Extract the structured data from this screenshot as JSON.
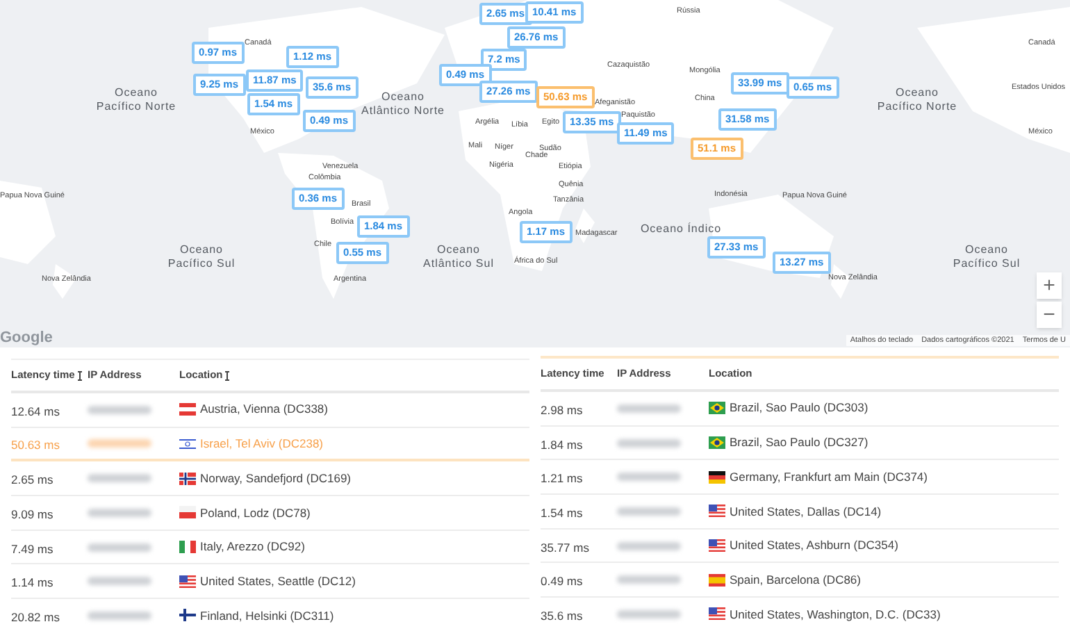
{
  "map": {
    "labels": [
      {
        "kind": "ocean",
        "text": "Oceano Pacífico Norte"
      },
      {
        "kind": "ocean",
        "text": "Oceano Atlântico Norte"
      },
      {
        "kind": "ocean",
        "text": "Oceano Pacífico Sul"
      },
      {
        "kind": "ocean",
        "text": "Oceano Atlântico Sul"
      },
      {
        "kind": "ocean",
        "text": "Oceano Índico"
      },
      {
        "kind": "ocean",
        "text": "Oceano Pacífico Norte"
      },
      {
        "kind": "ocean",
        "text": "Oceano Pacífico Sul"
      },
      {
        "kind": "country",
        "text": "Canadá"
      },
      {
        "kind": "country",
        "text": "México"
      },
      {
        "kind": "country",
        "text": "Venezuela"
      },
      {
        "kind": "country",
        "text": "Colômbia"
      },
      {
        "kind": "country",
        "text": "Brasil"
      },
      {
        "kind": "country",
        "text": "Bolívia"
      },
      {
        "kind": "country",
        "text": "Chile"
      },
      {
        "kind": "country",
        "text": "Argentina"
      },
      {
        "kind": "country",
        "text": "Papua Nova Guiné"
      },
      {
        "kind": "country",
        "text": "Nova Zelândia"
      },
      {
        "kind": "country",
        "text": "Argélia"
      },
      {
        "kind": "country",
        "text": "Líbia"
      },
      {
        "kind": "country",
        "text": "Mali"
      },
      {
        "kind": "country",
        "text": "Níger"
      },
      {
        "kind": "country",
        "text": "Chade"
      },
      {
        "kind": "country",
        "text": "Nigéria"
      },
      {
        "kind": "country",
        "text": "Angola"
      },
      {
        "kind": "country",
        "text": "Egito"
      },
      {
        "kind": "country",
        "text": "Sudão"
      },
      {
        "kind": "country",
        "text": "Etiópia"
      },
      {
        "kind": "country",
        "text": "Quênia"
      },
      {
        "kind": "country",
        "text": "Tanzânia"
      },
      {
        "kind": "country",
        "text": "Madagascar"
      },
      {
        "kind": "country",
        "text": "África do Sul"
      },
      {
        "kind": "country",
        "text": "Rússia"
      },
      {
        "kind": "country",
        "text": "Cazaquistão"
      },
      {
        "kind": "country",
        "text": "Mongólia"
      },
      {
        "kind": "country",
        "text": "China"
      },
      {
        "kind": "country",
        "text": "Afeganistão"
      },
      {
        "kind": "country",
        "text": "Paquistão"
      },
      {
        "kind": "country",
        "text": "Indonésia"
      },
      {
        "kind": "country",
        "text": "Papua Nova Guiné"
      },
      {
        "kind": "country",
        "text": "Nova Zelândia"
      },
      {
        "kind": "country",
        "text": "Canadá"
      },
      {
        "kind": "country",
        "text": "Estados Unidos"
      },
      {
        "kind": "country",
        "text": "México"
      }
    ],
    "markers": [
      {
        "text": "0.97 ms",
        "warning": false
      },
      {
        "text": "9.25 ms",
        "warning": false
      },
      {
        "text": "1.12 ms",
        "warning": false
      },
      {
        "text": "11.87 ms",
        "warning": false
      },
      {
        "text": "35.6 ms",
        "warning": false
      },
      {
        "text": "1.54 ms",
        "warning": false
      },
      {
        "text": "0.49 ms",
        "warning": false
      },
      {
        "text": "0.36 ms",
        "warning": false
      },
      {
        "text": "1.84 ms",
        "warning": false
      },
      {
        "text": "0.55 ms",
        "warning": false
      },
      {
        "text": "2.65 ms",
        "warning": false
      },
      {
        "text": "10.41 ms",
        "warning": false
      },
      {
        "text": "26.76 ms",
        "warning": false
      },
      {
        "text": "7.2 ms",
        "warning": false
      },
      {
        "text": "0.49 ms",
        "warning": false
      },
      {
        "text": "27.26 ms",
        "warning": false
      },
      {
        "text": "50.63 ms",
        "warning": true
      },
      {
        "text": "13.35 ms",
        "warning": false
      },
      {
        "text": "11.49 ms",
        "warning": false
      },
      {
        "text": "33.99 ms",
        "warning": false
      },
      {
        "text": "0.65 ms",
        "warning": false
      },
      {
        "text": "31.58 ms",
        "warning": false
      },
      {
        "text": "51.1 ms",
        "warning": true
      },
      {
        "text": "1.17 ms",
        "warning": false
      },
      {
        "text": "27.33 ms",
        "warning": false
      },
      {
        "text": "13.27 ms",
        "warning": false
      }
    ],
    "zoom_in": "+",
    "zoom_out": "−",
    "logo": "Google",
    "attribution": [
      "Atalhos do teclado",
      "Dados cartográficos ©2021",
      "Termos de U"
    ]
  },
  "tables": [
    {
      "columns": [
        {
          "label": "Latency time",
          "sortable": true
        },
        {
          "label": "IP Address",
          "sortable": false
        },
        {
          "label": "Location",
          "sortable": true
        }
      ],
      "rows": [
        {
          "latency": "12.64 ms",
          "kind": "at",
          "location": "Austria, Vienna (DC338)",
          "warning": false
        },
        {
          "latency": "50.63 ms",
          "kind": "il",
          "location": "Israel, Tel Aviv (DC238)",
          "warning": true
        },
        {
          "latency": "2.65 ms",
          "kind": "no",
          "location": "Norway, Sandefjord (DC169)",
          "warning": false
        },
        {
          "latency": "9.09 ms",
          "kind": "pl",
          "location": "Poland, Lodz (DC78)",
          "warning": false
        },
        {
          "latency": "7.49 ms",
          "kind": "it",
          "location": "Italy, Arezzo (DC92)",
          "warning": false
        },
        {
          "latency": "1.14 ms",
          "kind": "us",
          "location": "United States, Seattle (DC12)",
          "warning": false
        },
        {
          "latency": "20.82 ms",
          "kind": "fi",
          "location": "Finland, Helsinki (DC311)",
          "warning": false
        }
      ]
    },
    {
      "columns": [
        {
          "label": "Latency time",
          "sortable": false
        },
        {
          "label": "IP Address",
          "sortable": false
        },
        {
          "label": "Location",
          "sortable": false
        }
      ],
      "rows": [
        {
          "latency": "2.98 ms",
          "kind": "br",
          "location": "Brazil, Sao Paulo (DC303)",
          "warning": false
        },
        {
          "latency": "1.84 ms",
          "kind": "br",
          "location": "Brazil, Sao Paulo (DC327)",
          "warning": false
        },
        {
          "latency": "1.21 ms",
          "kind": "de",
          "location": "Germany, Frankfurt am Main (DC374)",
          "warning": false
        },
        {
          "latency": "1.54 ms",
          "kind": "us",
          "location": "United States, Dallas (DC14)",
          "warning": false
        },
        {
          "latency": "35.77 ms",
          "kind": "us",
          "location": "United States, Ashburn (DC354)",
          "warning": false
        },
        {
          "latency": "0.49 ms",
          "kind": "es",
          "location": "Spain, Barcelona (DC86)",
          "warning": false
        },
        {
          "latency": "35.6 ms",
          "kind": "us",
          "location": "United States, Washington, D.C. (DC33)",
          "warning": false
        }
      ]
    }
  ]
}
